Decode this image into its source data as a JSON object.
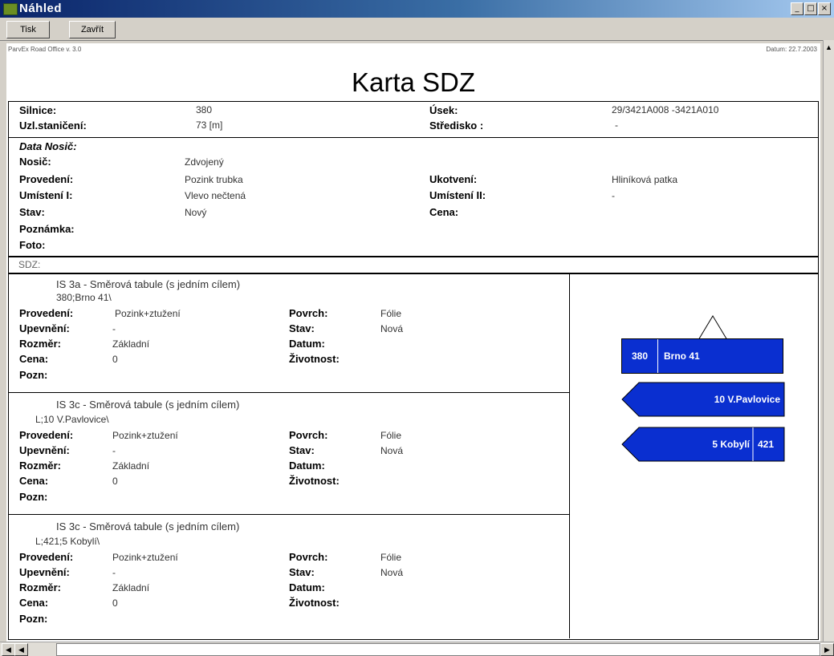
{
  "window": {
    "title": "Náhled"
  },
  "toolbar": {
    "print_label": "Tisk",
    "close_label": "Zavřít"
  },
  "report": {
    "header_left": "ParvEx Road Office v. 3.0",
    "header_right": "Datum: 22.7.2003",
    "title": "Karta SDZ",
    "silnice_label": "Silnice:",
    "silnice": "380",
    "usek_label": "Úsek:",
    "usek": "29/3421A008 -3421A010",
    "uzl_label": "Uzl.staničení:",
    "uzl": "73 [m]",
    "stredisko_label": "Středisko :",
    "stredisko": "-",
    "data_nosic_label": "Data Nosič:",
    "nosic_label": "Nosič:",
    "nosic": "Zdvojený",
    "provedeni_label": "Provedení:",
    "provedeni": "Pozink trubka",
    "ukotveni_label": "Ukotvení:",
    "ukotveni": "Hliníková patka",
    "umisteni1_label": "Umístení I:",
    "umisteni1": "Vlevo nečtená",
    "umisteni2_label": "Umístení II:",
    "umisteni2": "-",
    "stav_label": "Stav:",
    "stav": "Nový",
    "cena_label": "Cena:",
    "cena": "",
    "poznamka_label": "Poznámka:",
    "foto_label": "Foto:",
    "sdz_label": "SDZ:"
  },
  "sdz_items": [
    {
      "title": "IS 3a - Směrová tabule (s jedním cílem)",
      "subtitle": "380;Brno 41\\",
      "provedeni_label": "Provedení:",
      "provedeni": "Pozink+ztužení",
      "povrch_label": "Povrch:",
      "povrch": "Fólie",
      "upevneni_label": "Upevnění:",
      "upevneni": "-",
      "stav_label": "Stav:",
      "stav": "Nová",
      "rozmer_label": "Rozměr:",
      "rozmer": "Základní",
      "datum_label": "Datum:",
      "cena_label": "Cena:",
      "cena": "0",
      "zivotnost_label": "Životnost:",
      "pozn_label": "Pozn:"
    },
    {
      "title": "IS 3c - Směrová tabule (s jedním cílem)",
      "subtitle": "L;10 V.Pavlovice\\",
      "provedeni_label": "Provedení:",
      "provedeni": "Pozink+ztužení",
      "povrch_label": "Povrch:",
      "povrch": "Fólie",
      "upevneni_label": "Upevnění:",
      "upevneni": "-",
      "stav_label": "Stav:",
      "stav": "Nová",
      "rozmer_label": "Rozměr:",
      "rozmer": "Základní",
      "datum_label": "Datum:",
      "cena_label": "Cena:",
      "cena": "0",
      "zivotnost_label": "Životnost:",
      "pozn_label": "Pozn:"
    },
    {
      "title": "IS 3c - Směrová tabule (s jedním cílem)",
      "subtitle": "L;421;5 Kobylí\\",
      "provedeni_label": "Provedení:",
      "provedeni": "Pozink+ztužení",
      "povrch_label": "Povrch:",
      "povrch": "Fólie",
      "upevneni_label": "Upevnění:",
      "upevneni": "-",
      "stav_label": "Stav:",
      "stav": "Nová",
      "rozmer_label": "Rozměr:",
      "rozmer": "Základní",
      "datum_label": "Datum:",
      "cena_label": "Cena:",
      "cena": "0",
      "zivotnost_label": "Životnost:",
      "pozn_label": "Pozn:"
    }
  ],
  "signs": {
    "sign1_road": "380",
    "sign1_dest": "Brno 41",
    "sign2_dest": "10 V.Pavlovice",
    "sign3_dest": "5 Kobylí",
    "sign3_road": "421",
    "color": "#0a2fd0"
  }
}
